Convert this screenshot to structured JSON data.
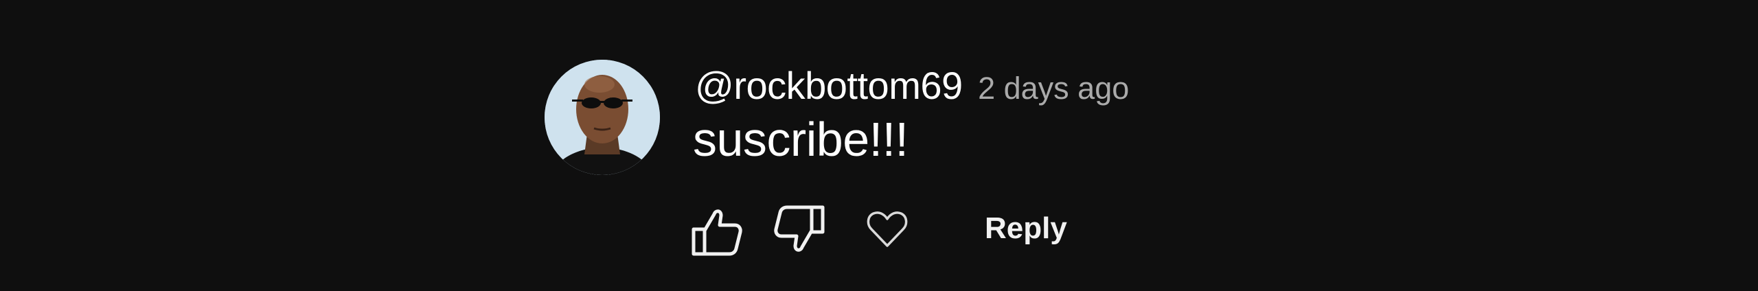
{
  "comment": {
    "author": "@rockbottom69",
    "timestamp": "2 days ago",
    "text": "suscribe!!!",
    "avatar_icon": "user-avatar-photo"
  },
  "actions": {
    "like_icon": "thumbs-up-icon",
    "dislike_icon": "thumbs-down-icon",
    "heart_icon": "heart-icon",
    "reply_label": "Reply"
  },
  "colors": {
    "background": "#0f0f0f",
    "primary_text": "#ffffff",
    "secondary_text": "#aaaaaa"
  }
}
